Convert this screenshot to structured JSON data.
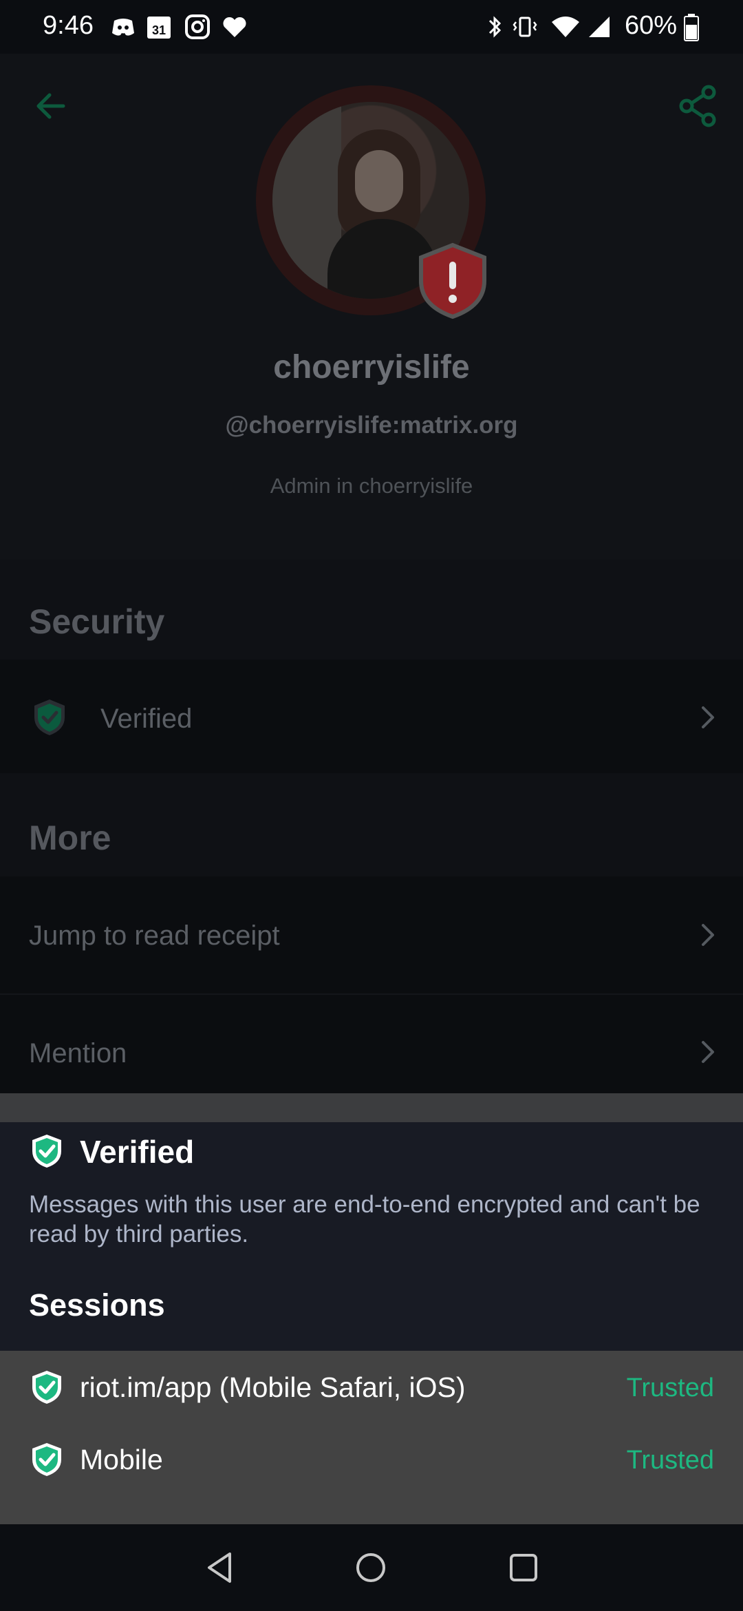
{
  "status_bar": {
    "time": "9:46",
    "battery": "60%",
    "icons": [
      "discord-icon",
      "calendar-icon",
      "instagram-icon",
      "heart-icon",
      "bluetooth-icon",
      "vibrate-icon",
      "wifi-icon",
      "signal-icon",
      "battery-icon"
    ]
  },
  "profile": {
    "display_name": "choerryislife",
    "matrix_id": "@choerryislife:matrix.org",
    "role": "Admin in choerryislife"
  },
  "security": {
    "title": "Security",
    "verified_label": "Verified"
  },
  "more": {
    "title": "More",
    "items": [
      {
        "label": "Jump to read receipt"
      },
      {
        "label": "Mention"
      }
    ]
  },
  "sheet": {
    "title": "Verified",
    "description": "Messages with this user are end-to-end encrypted and can't be read by third parties.",
    "sessions_title": "Sessions",
    "sessions": [
      {
        "name": "riot.im/app (Mobile Safari, iOS)",
        "status": "Trusted"
      },
      {
        "name": "Mobile",
        "status": "Trusted"
      }
    ]
  },
  "colors": {
    "accent_green": "#1db881",
    "warning_red": "#b3262d"
  }
}
